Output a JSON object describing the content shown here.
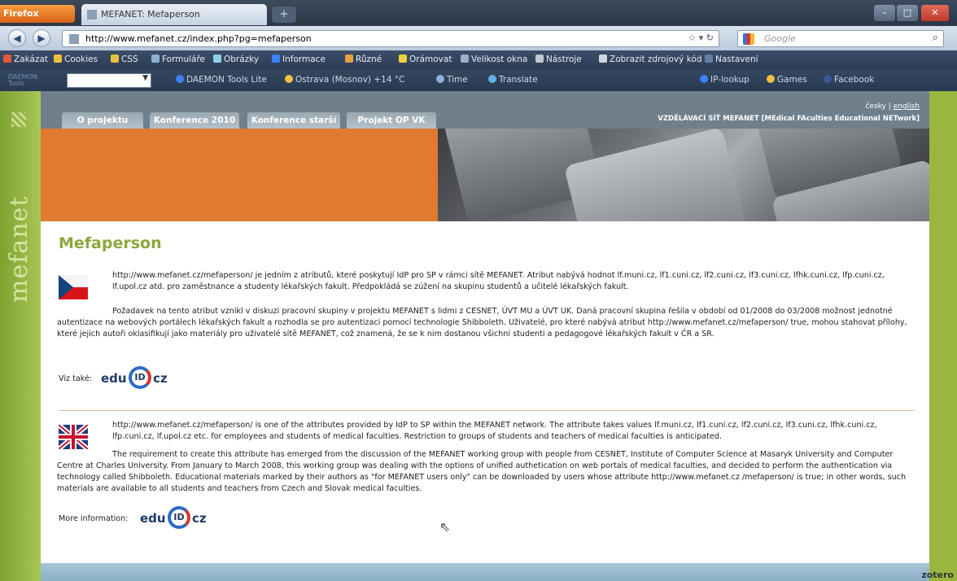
{
  "browser": {
    "app_button": "Firefox",
    "tab_title": "MEFANET: Mefaperson",
    "new_tab": "+",
    "url": "http://www.mefanet.cz/index.php?pg=mefaperson",
    "search_placeholder": "Google"
  },
  "bookmarks": [
    {
      "label": "Zakázat",
      "color": "#e05a3a"
    },
    {
      "label": "Cookies",
      "color": "#f0c040"
    },
    {
      "label": "CSS",
      "color": "#e8c040"
    },
    {
      "label": "Formuláře",
      "color": "#8fb0d8"
    },
    {
      "label": "Obrázky",
      "color": "#8fd0e8"
    },
    {
      "label": "Informace",
      "color": "#3b82f6"
    },
    {
      "label": "Různé",
      "color": "#e8a040"
    },
    {
      "label": "Orámovat",
      "color": "#f0d040"
    },
    {
      "label": "Velikost okna",
      "color": "#9ab0c8"
    },
    {
      "label": "Nástroje",
      "color": "#c0c8d0"
    },
    {
      "label": "Zobrazit zdrojový kód",
      "color": "#d0d8e0"
    },
    {
      "label": "Nastavení",
      "color": "#6080a0"
    }
  ],
  "toolbar3": {
    "daemon_line1": "DAEMON",
    "daemon_line2": "Tools",
    "items": [
      {
        "label": "DAEMON Tools Lite",
        "color": "#3b82f6"
      },
      {
        "label": "Ostrava (Mosnov) +14 °C",
        "color": "#f0c040"
      },
      {
        "label": "Time",
        "color": "#8fb0d8"
      },
      {
        "label": "Translate",
        "color": "#60b0e8"
      }
    ],
    "right_items": [
      {
        "label": "IP-lookup",
        "color": "#3b82f6"
      },
      {
        "label": "Games",
        "color": "#f0c040"
      },
      {
        "label": "Facebook",
        "color": "#3b5998"
      }
    ]
  },
  "site": {
    "brand": "mefanet",
    "nav": [
      "O projektu",
      "Konference 2010",
      "Konference starší",
      "Projekt OP VK"
    ],
    "lang_cz": "česky",
    "lang_sep": "|",
    "lang_en": "english",
    "network": "VZDĚLÁVACÍ SÍŤ MEFANET [MEdical FAculties Educational NETwork]"
  },
  "content": {
    "title": "Mefaperson",
    "cz_p1": "http://www.mefanet.cz/mefaperson/ je jedním z atributů, které poskytují IdP pro SP v rámci sítě MEFANET. Atribut nabývá hodnot lf.muni.cz, lf1.cuni.cz, lf2.cuni.cz, lf3.cuni.cz, lfhk.cuni.cz, lfp.cuni.cz, lf.upol.cz atd. pro zaměstnance a studenty lékařských fakult. Předpokládá se zúžení na skupinu studentů a učitelé lékařských fakult.",
    "cz_p2": "Požadavek na tento atribut vznikl v diskuzi pracovní skupiny v projektu MEFANET s lidmi z CESNET, ÚVT MU a ÚVT UK. Daná pracovní skupina řešila v období od 01/2008 do 03/2008 možnost jednotné autentizace na webových portálech lékařských fakult a rozhodla se pro autentizaci pomocí technologie Shibboleth. Uživatelé, pro které nabývá atribut http://www.mefanet.cz/mefaperson/ true, mohou stahovat přílohy, které jejich autoři oklasifikují jako materiály pro uživatelé sítě MEFANET, což znamená, že se k nim dostanou všichni studenti a pedagogové lékařských fakult v ČR a SR.",
    "see_also": "Viz také:",
    "en_p1": "http://www.mefanet.cz/mefaperson/ is one of the attributes provided by IdP to SP within the MEFANET network. The attribute takes values lf.muni.cz, lf1.cuni.cz, lf2.cuni.cz, lf3.cuni.cz, lfhk.cuni.cz, lfp.cuni.cz, lf.upol.cz etc. for employees and students of medical faculties. Restriction to groups of students and teachers of medical faculties is anticipated.",
    "en_p2": "The requirement to create this attribute has emerged from the discussion of the MEFANET working group with people from CESNET, Institute of Computer Science at Masaryk University and Computer Centre at Charles University. From January to March 2008, this working group was dealing with the options of unified authetication on web portals of medical faculties, and decided to perform the authentication via technology called Shibboleth. Educational materials marked by their authors as \"for MEFANET users only\" can be downloaded by users whose attribute http://www.mefanet.cz /mefaperson/ is true; in other words, such materials are available to all students and teachers from Czech and Slovak medical faculties.",
    "more_info": "More information:",
    "logo_edu": "edu",
    "logo_id": "ID",
    "logo_cz": "cz"
  },
  "addon": "zotero"
}
